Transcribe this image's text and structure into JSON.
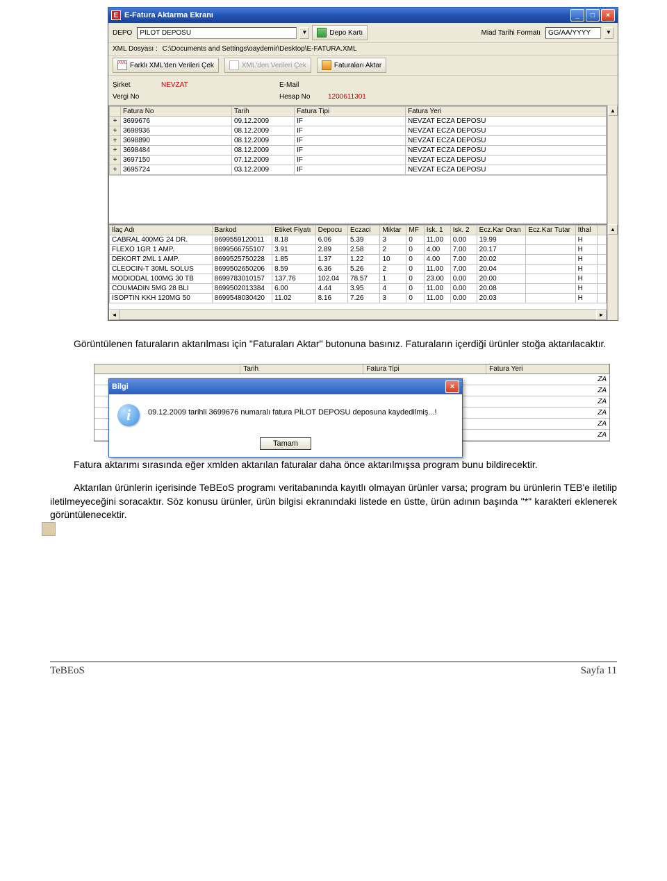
{
  "window": {
    "title": "E-Fatura Aktarma Ekranı",
    "app_icon_letter": "E"
  },
  "toolbar": {
    "depo_label": "DEPO",
    "depo_value": "PİLOT DEPOSU",
    "depo_karti_btn": "Depo Kartı",
    "miad_label": "Miad Tarihi Formatı",
    "miad_value": "GG/AA/YYYY",
    "xml_label": "XML Dosyası :",
    "xml_path": "C:\\Documents and Settings\\oaydemir\\Desktop\\E-FATURA.XML",
    "btn_farkli": "Farklı XML'den Verileri Çek",
    "btn_xmlden": "XML'den Verileri Çek",
    "btn_aktar": "Faturaları Aktar"
  },
  "info": {
    "sirket_label": "Şirket",
    "sirket_value": "NEVZAT",
    "email_label": "E-Mail",
    "email_value": "",
    "vergi_label": "Vergi No",
    "vergi_value": "",
    "hesap_label": "Hesap No",
    "hesap_value": "1200611301"
  },
  "invoice_table": {
    "columns": [
      "Fatura No",
      "Tarih",
      "Fatura Tipi",
      "Fatura Yeri"
    ],
    "rows": [
      {
        "no": "3699676",
        "tarih": "09.12.2009",
        "tip": "IF",
        "yer": "NEVZAT ECZA DEPOSU"
      },
      {
        "no": "3698936",
        "tarih": "08.12.2009",
        "tip": "IF",
        "yer": "NEVZAT ECZA DEPOSU"
      },
      {
        "no": "3698890",
        "tarih": "08.12.2009",
        "tip": "IF",
        "yer": "NEVZAT ECZA DEPOSU"
      },
      {
        "no": "3698484",
        "tarih": "08.12.2009",
        "tip": "IF",
        "yer": "NEVZAT ECZA DEPOSU"
      },
      {
        "no": "3697150",
        "tarih": "07.12.2009",
        "tip": "IF",
        "yer": "NEVZAT ECZA DEPOSU"
      },
      {
        "no": "3695724",
        "tarih": "03.12.2009",
        "tip": "IF",
        "yer": "NEVZAT ECZA DEPOSU"
      }
    ]
  },
  "product_table": {
    "columns": [
      "İlaç Adı",
      "Barkod",
      "Etiket Fiyatı",
      "Depocu",
      "Eczaci",
      "Miktar",
      "MF",
      "Isk. 1",
      "Isk. 2",
      "Ecz.Kar Oran",
      "Ecz.Kar Tutar",
      "İthal",
      ""
    ],
    "rows": [
      {
        "ad": "CABRAL 400MG 24 DR.",
        "barkod": "8699559120011",
        "etk": "8.18",
        "depo": "6.06",
        "ecz": "5.39",
        "mik": "3",
        "mf": "0",
        "i1": "11.00",
        "i2": "0.00",
        "kar": "19.99",
        "tut": "",
        "ith": "H",
        "e": ""
      },
      {
        "ad": "FLEXO 1GR 1 AMP.",
        "barkod": "8699566755107",
        "etk": "3.91",
        "depo": "2.89",
        "ecz": "2.58",
        "mik": "2",
        "mf": "0",
        "i1": "4.00",
        "i2": "7.00",
        "kar": "20.17",
        "tut": "",
        "ith": "H",
        "e": ""
      },
      {
        "ad": "DEKORT 2ML 1 AMP.",
        "barkod": "8699525750228",
        "etk": "1.85",
        "depo": "1.37",
        "ecz": "1.22",
        "mik": "10",
        "mf": "0",
        "i1": "4.00",
        "i2": "7.00",
        "kar": "20.02",
        "tut": "",
        "ith": "H",
        "e": ""
      },
      {
        "ad": "CLEOCIN-T 30ML SOLUS",
        "barkod": "8699502650206",
        "etk": "8.59",
        "depo": "6.36",
        "ecz": "5.26",
        "mik": "2",
        "mf": "0",
        "i1": "11.00",
        "i2": "7.00",
        "kar": "20.04",
        "tut": "",
        "ith": "H",
        "e": ""
      },
      {
        "ad": "MODIODAL 100MG 30 TB",
        "barkod": "8699783010157",
        "etk": "137.76",
        "depo": "102.04",
        "ecz": "78.57",
        "mik": "1",
        "mf": "0",
        "i1": "23.00",
        "i2": "0.00",
        "kar": "20.00",
        "tut": "",
        "ith": "H",
        "e": ""
      },
      {
        "ad": "COUMADIN 5MG 28 BLI",
        "barkod": "8699502013384",
        "etk": "6.00",
        "depo": "4.44",
        "ecz": "3.95",
        "mik": "4",
        "mf": "0",
        "i1": "11.00",
        "i2": "0.00",
        "kar": "20.08",
        "tut": "",
        "ith": "H",
        "e": ""
      },
      {
        "ad": "ISOPTIN KKH 120MG 50",
        "barkod": "8699548030420",
        "etk": "11.02",
        "depo": "8.16",
        "ecz": "7.26",
        "mik": "3",
        "mf": "0",
        "i1": "11.00",
        "i2": "0.00",
        "kar": "20.03",
        "tut": "",
        "ith": "H",
        "e": ""
      }
    ]
  },
  "paragraphs": {
    "p1": "Görüntülenen faturaların aktarılması için \"Faturaları Aktar\" butonuna basınız. Faturaların içerdiği ürünler stoğa aktarılacaktır.",
    "p2": "Fatura aktarımı sırasında eğer xmlden aktarılan faturalar daha önce aktarılmışsa program bunu bildirecektir.",
    "p3": "Aktarılan ürünlerin içerisinde TeBEoS programı veritabanında kayıtlı olmayan ürünler varsa; program bu ürünlerin TEB'e iletilip iletilmeyeceğini soracaktır. Söz konusu ürünler, ürün bilgisi ekranındaki listede en üstte, ürün adının başında \"*\" karakteri eklenerek görüntülenecektir."
  },
  "snippet2": {
    "columns": [
      "",
      "Tarih",
      "Fatura Tipi",
      "Fatura Yeri"
    ],
    "stripe_text": "ZA"
  },
  "dialog": {
    "title": "Bilgi",
    "message": "09.12.2009 tarihli 3699676 numaralı fatura PİLOT DEPOSU deposuna kaydedilmiş...!",
    "ok": "Tamam"
  },
  "footer": {
    "left": "TeBEoS",
    "right": "Sayfa 11"
  }
}
